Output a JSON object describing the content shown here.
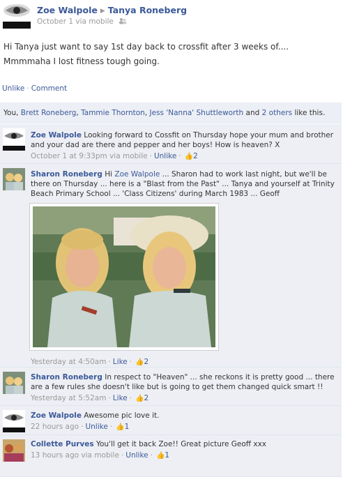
{
  "post": {
    "author": "Zoe Walpole",
    "target": "Tanya Roneberg",
    "meta": "October 1 via mobile",
    "text": "Hi Tanya just want to say 1st day back to crossfit after 3 weeks of.... Mmmmaha I lost fitness tough going.",
    "unlike": "Unlike",
    "comment": "Comment"
  },
  "likes": {
    "prefix": "You, ",
    "names": [
      "Brett Roneberg",
      "Tammie Thornton",
      "Jess 'Nanna' Shuttleworth"
    ],
    "others": "2 others",
    "suffix": " like this."
  },
  "comments": [
    {
      "author": "Zoe Walpole",
      "text": "Looking forward to Cossfit on Thursday hope your mum and brother and your dad are there and pepper and her boys! How is heaven? X",
      "time": "October 1 at 9:33pm via mobile",
      "action": "Unlike",
      "likes": "2"
    },
    {
      "author": "Sharon Roneberg",
      "text_pre": "Hi ",
      "mention": "Zoe Walpole",
      "text": " ... Sharon had to work last night, but we'll be there on Thursday ... here is a \"Blast from the Past\" ... Tanya and yourself at Trinity Beach Primary School ... 'Class Citizens' during March 1983 ... Geoff",
      "time": "Yesterday at 4:50am",
      "action": "Like",
      "likes": "2"
    },
    {
      "author": "Sharon Roneberg",
      "text": "In respect to \"Heaven\" ... she reckons it is pretty good ... there are a few rules she doesn't like but is going to get them changed quick smart !!",
      "time": "Yesterday at 5:52am",
      "action": "Like",
      "likes": "2"
    },
    {
      "author": "Zoe Walpole",
      "text": "Awesome pic love it.",
      "time": "22 hours ago",
      "action": "Unlike",
      "likes": "1"
    },
    {
      "author": "Collette Purves",
      "text": "You'll get it back Zoe!! Great picture Geoff xxx",
      "time": "13 hours ago via mobile",
      "action": "Unlike",
      "likes": "1"
    }
  ],
  "colors": {
    "link": "#3b5998",
    "meta": "#999999",
    "comment_bg": "#edeff4"
  }
}
